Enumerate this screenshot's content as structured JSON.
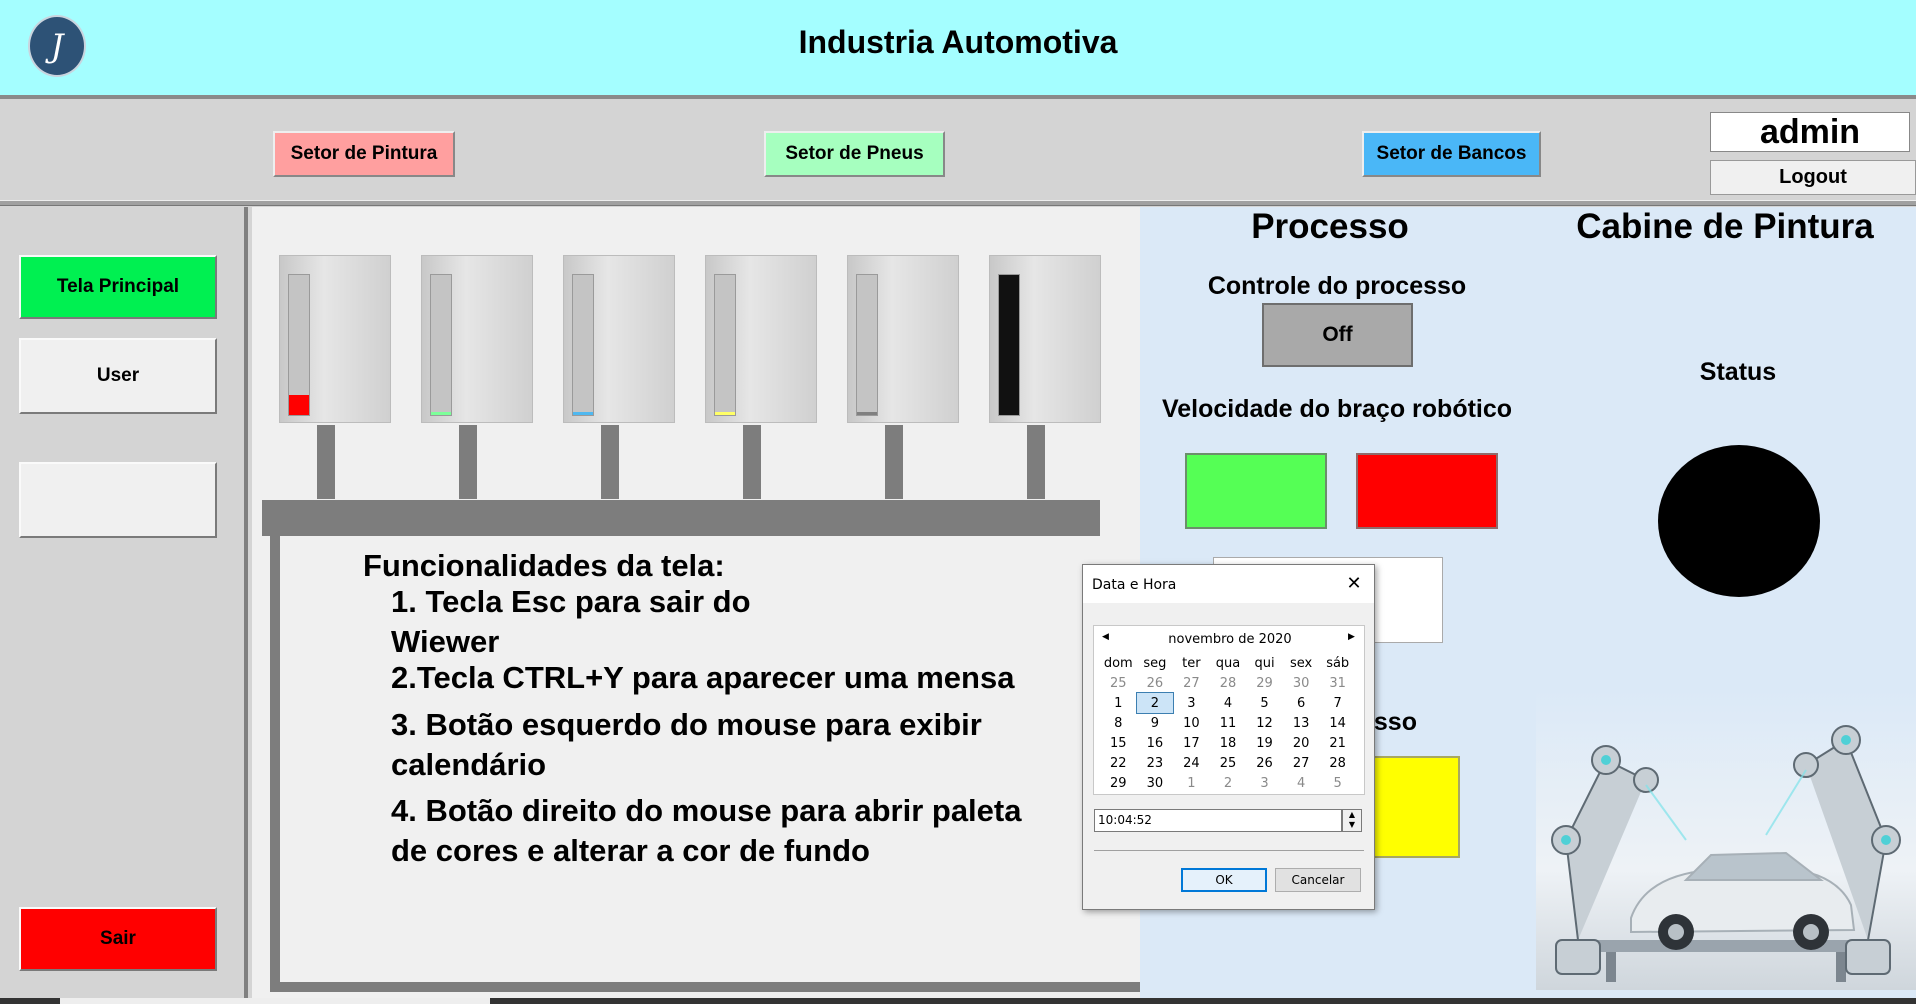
{
  "header": {
    "title": "Industria Automotiva",
    "logo_letter": "J"
  },
  "toolbar": {
    "sectors": [
      "Setor de Pintura",
      "Setor de Pneus",
      "Setor de Bancos"
    ],
    "user": "admin",
    "logout": "Logout"
  },
  "sidebar": {
    "tela_principal": "Tela Principal",
    "user": "User",
    "blank": "",
    "sair": "Sair"
  },
  "tanks": [
    {
      "color": "#ff0000",
      "level": 0.14
    },
    {
      "color": "#7dff9a",
      "level": 0.02
    },
    {
      "color": "#4fb8f0",
      "level": 0.02
    },
    {
      "color": "#ffff66",
      "level": 0.02
    },
    {
      "color": "#808080",
      "level": 0.02
    },
    {
      "color": "#111111",
      "level": 1.0
    }
  ],
  "functions": {
    "title": "Funcionalidades da tela:",
    "item1_line1": "1. Tecla Esc para sair do",
    "item1_line2": "Wiewer",
    "item2": "2.Tecla CTRL+Y para aparecer uma mensa",
    "item3_line1": "3. Botão esquerdo do mouse para exibir",
    "item3_line2": "calendário",
    "item4_line1": "4. Botão direito do mouse para abrir paleta",
    "item4_line2": "de cores e alterar a cor de fundo"
  },
  "processo": {
    "title": "Processo",
    "control_label": "Controle do processo",
    "off": "Off",
    "speed_label": "Velocidade do braço robótico",
    "partial_label": "esso"
  },
  "cabine": {
    "title": "Cabine de Pintura",
    "status_label": "Status"
  },
  "dialog": {
    "title": "Data e Hora",
    "month": "novembro de 2020",
    "weekdays": [
      "dom",
      "seg",
      "ter",
      "qua",
      "qui",
      "sex",
      "sáb"
    ],
    "weeks": [
      [
        "25",
        "26",
        "27",
        "28",
        "29",
        "30",
        "31"
      ],
      [
        "1",
        "2",
        "3",
        "4",
        "5",
        "6",
        "7"
      ],
      [
        "8",
        "9",
        "10",
        "11",
        "12",
        "13",
        "14"
      ],
      [
        "15",
        "16",
        "17",
        "18",
        "19",
        "20",
        "21"
      ],
      [
        "22",
        "23",
        "24",
        "25",
        "26",
        "27",
        "28"
      ],
      [
        "29",
        "30",
        "1",
        "2",
        "3",
        "4",
        "5"
      ]
    ],
    "selected_day": "2",
    "time": "10:04:52",
    "ok": "OK",
    "cancel": "Cancelar"
  }
}
